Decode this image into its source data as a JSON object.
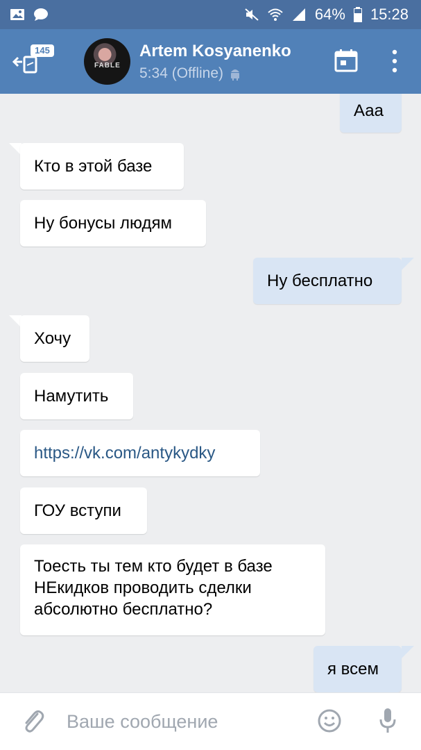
{
  "status_bar": {
    "battery": "64%",
    "time": "15:28",
    "icons": [
      "gallery-icon",
      "chat-icon",
      "mute-icon",
      "wifi-icon",
      "signal-icon",
      "battery-icon"
    ]
  },
  "header": {
    "unread_badge": "145",
    "contact_name": "Artem Kosyanenko",
    "last_seen": "5:34 (Offline)",
    "avatar_text": "FABLE"
  },
  "messages": [
    {
      "side": "out",
      "text": "Ааа"
    },
    {
      "side": "in",
      "text": "Кто в этой базе"
    },
    {
      "side": "in",
      "text": "Ну бонусы людям"
    },
    {
      "side": "out",
      "text": "Ну бесплатно"
    },
    {
      "side": "in",
      "text": "Хочу"
    },
    {
      "side": "in",
      "text": "Намутить"
    },
    {
      "side": "in",
      "text": "https://vk.com/antykydky"
    },
    {
      "side": "in",
      "text": "ГОУ вступи"
    },
    {
      "side": "in",
      "text": "Тоесть ты тем кто будет в базе НЕкидков проводить сделки абсолютно бесплатно?"
    },
    {
      "side": "out",
      "text": "я всем"
    }
  ],
  "composer": {
    "placeholder": "Ваше сообщение"
  },
  "colors": {
    "header": "#5181b8",
    "status_bar": "#4a6fa0",
    "incoming_bubble": "#ffffff",
    "outgoing_bubble": "#d9e5f4",
    "link": "#2a5885"
  }
}
